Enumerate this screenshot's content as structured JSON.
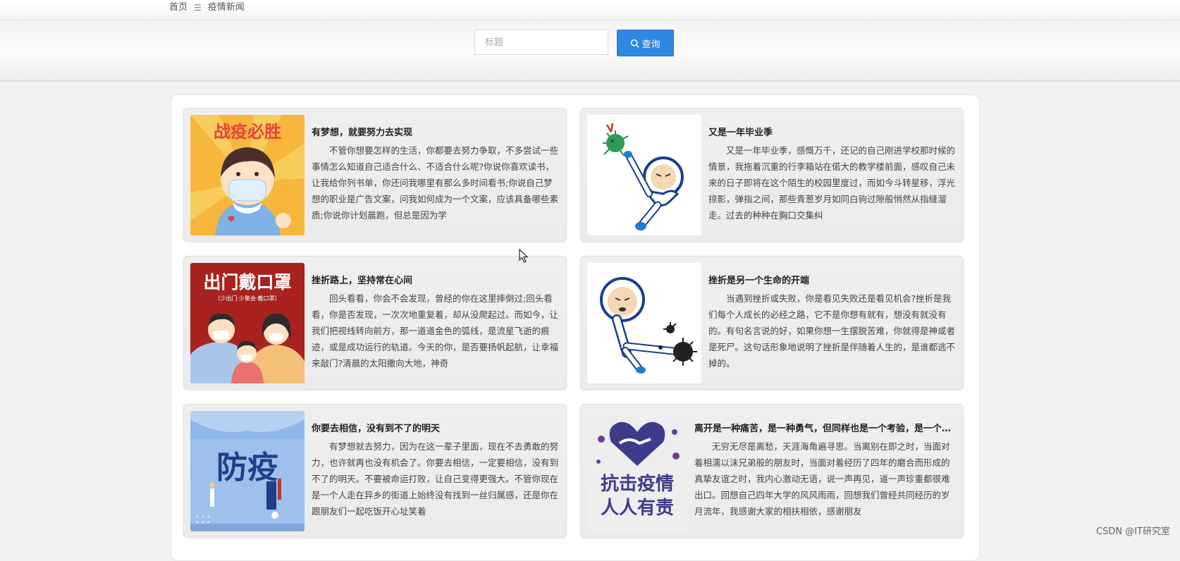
{
  "breadcrumb": {
    "home": "首页",
    "separator": "☰",
    "current": "疫情新闻"
  },
  "search": {
    "placeholder": "标题",
    "value": "",
    "button_label": "查询",
    "button_color": "#2d88e1"
  },
  "news": [
    {
      "title": "有梦想，就要努力去实现",
      "summary": "不管你想要怎样的生活，你都要去努力争取，不多尝试一些事情怎么知道自己适合什么、不适合什么呢?你说你喜欢读书，让我给你列书单，你还问我哪里有那么多时间看书;你说自己梦想的职业是广告文案，问我如何成为一个文案，应该具备哪些素质;你说你计划晨跑，但总是因为学",
      "image_text": "战疫必胜"
    },
    {
      "title": "又是一年毕业季",
      "summary": "又是一年毕业季，感慨万千，还记的自己刚进学校那时候的情景，我拖着沉重的行李箱站在偌大的教学楼前面，感叹自己未来的日子即将在这个陌生的校园里度过，而如今斗转星移，浮光掠影，弹指之间，那些青葱岁月如同白驹过隙般悄然从指缝溜走。过去的种种在胸口交集纠",
      "image_text": ""
    },
    {
      "title": "挫折路上，坚持常在心间",
      "summary": "回头看看，你会不会发现，曾经的你在这里摔倒过;回头看看，你是否发现，一次次地重复着，却从没爬起过。而如今，让我们把视线转向前方，那一道道金色的弧线，是流星飞逝的痕迹，或是成功运行的轨道。今天的你，是否要扬帆起航，让幸福来敲门?清晨的太阳撒向大地，神奇",
      "image_text": "出门戴口罩",
      "image_subtext": "（少出门·少聚会·戴口罩）"
    },
    {
      "title": "挫折是另一个生命的开端",
      "summary": "当遇到挫折或失败，你是看见失败还是看见机会?挫折是我们每个人成长的必经之路，它不是你想有就有，想没有就没有的。有句名言说的好，如果你想一生摆脱苦难，你就得是神或者是死尸。这句话形象地说明了挫折是伴随着人生的，是谁都逃不掉的。",
      "image_text": ""
    },
    {
      "title": "你要去相信，没有到不了的明天",
      "summary": "有梦想就去努力，因为在这一辈子里面，现在不去勇敢的努力，也许就再也没有机会了。你要去相信，一定要相信，没有到不了的明天。不要被命运打败，让自己变得更强大。不管你现在是一个人走在异乡的街道上始终没有找到一丝归属感，还是你在跟朋友们一起吃饭开心址笑着",
      "image_text": "防疫"
    },
    {
      "title": "离开是一种痛苦，是一种勇气，但同样也是一个考验，是一个新的开始",
      "summary": "无穷无尽是离愁，天涯海角遍寻思。当离别在即之时，当面对着相濡以沫兄弟般的朋友时，当面对着经历了四年的磨合而形成的真挚友谊之时，我内心激动无语，说一声再见，道一声珍重都很难出口。回想自己四年大学的风风雨雨，回想我们曾经共同经历的岁月流年，我感谢大家的相扶相依，感谢朋友",
      "image_text": "抗击疫情",
      "image_subtext": "人人有责"
    }
  ],
  "watermark": "CSDN @IT研究室"
}
